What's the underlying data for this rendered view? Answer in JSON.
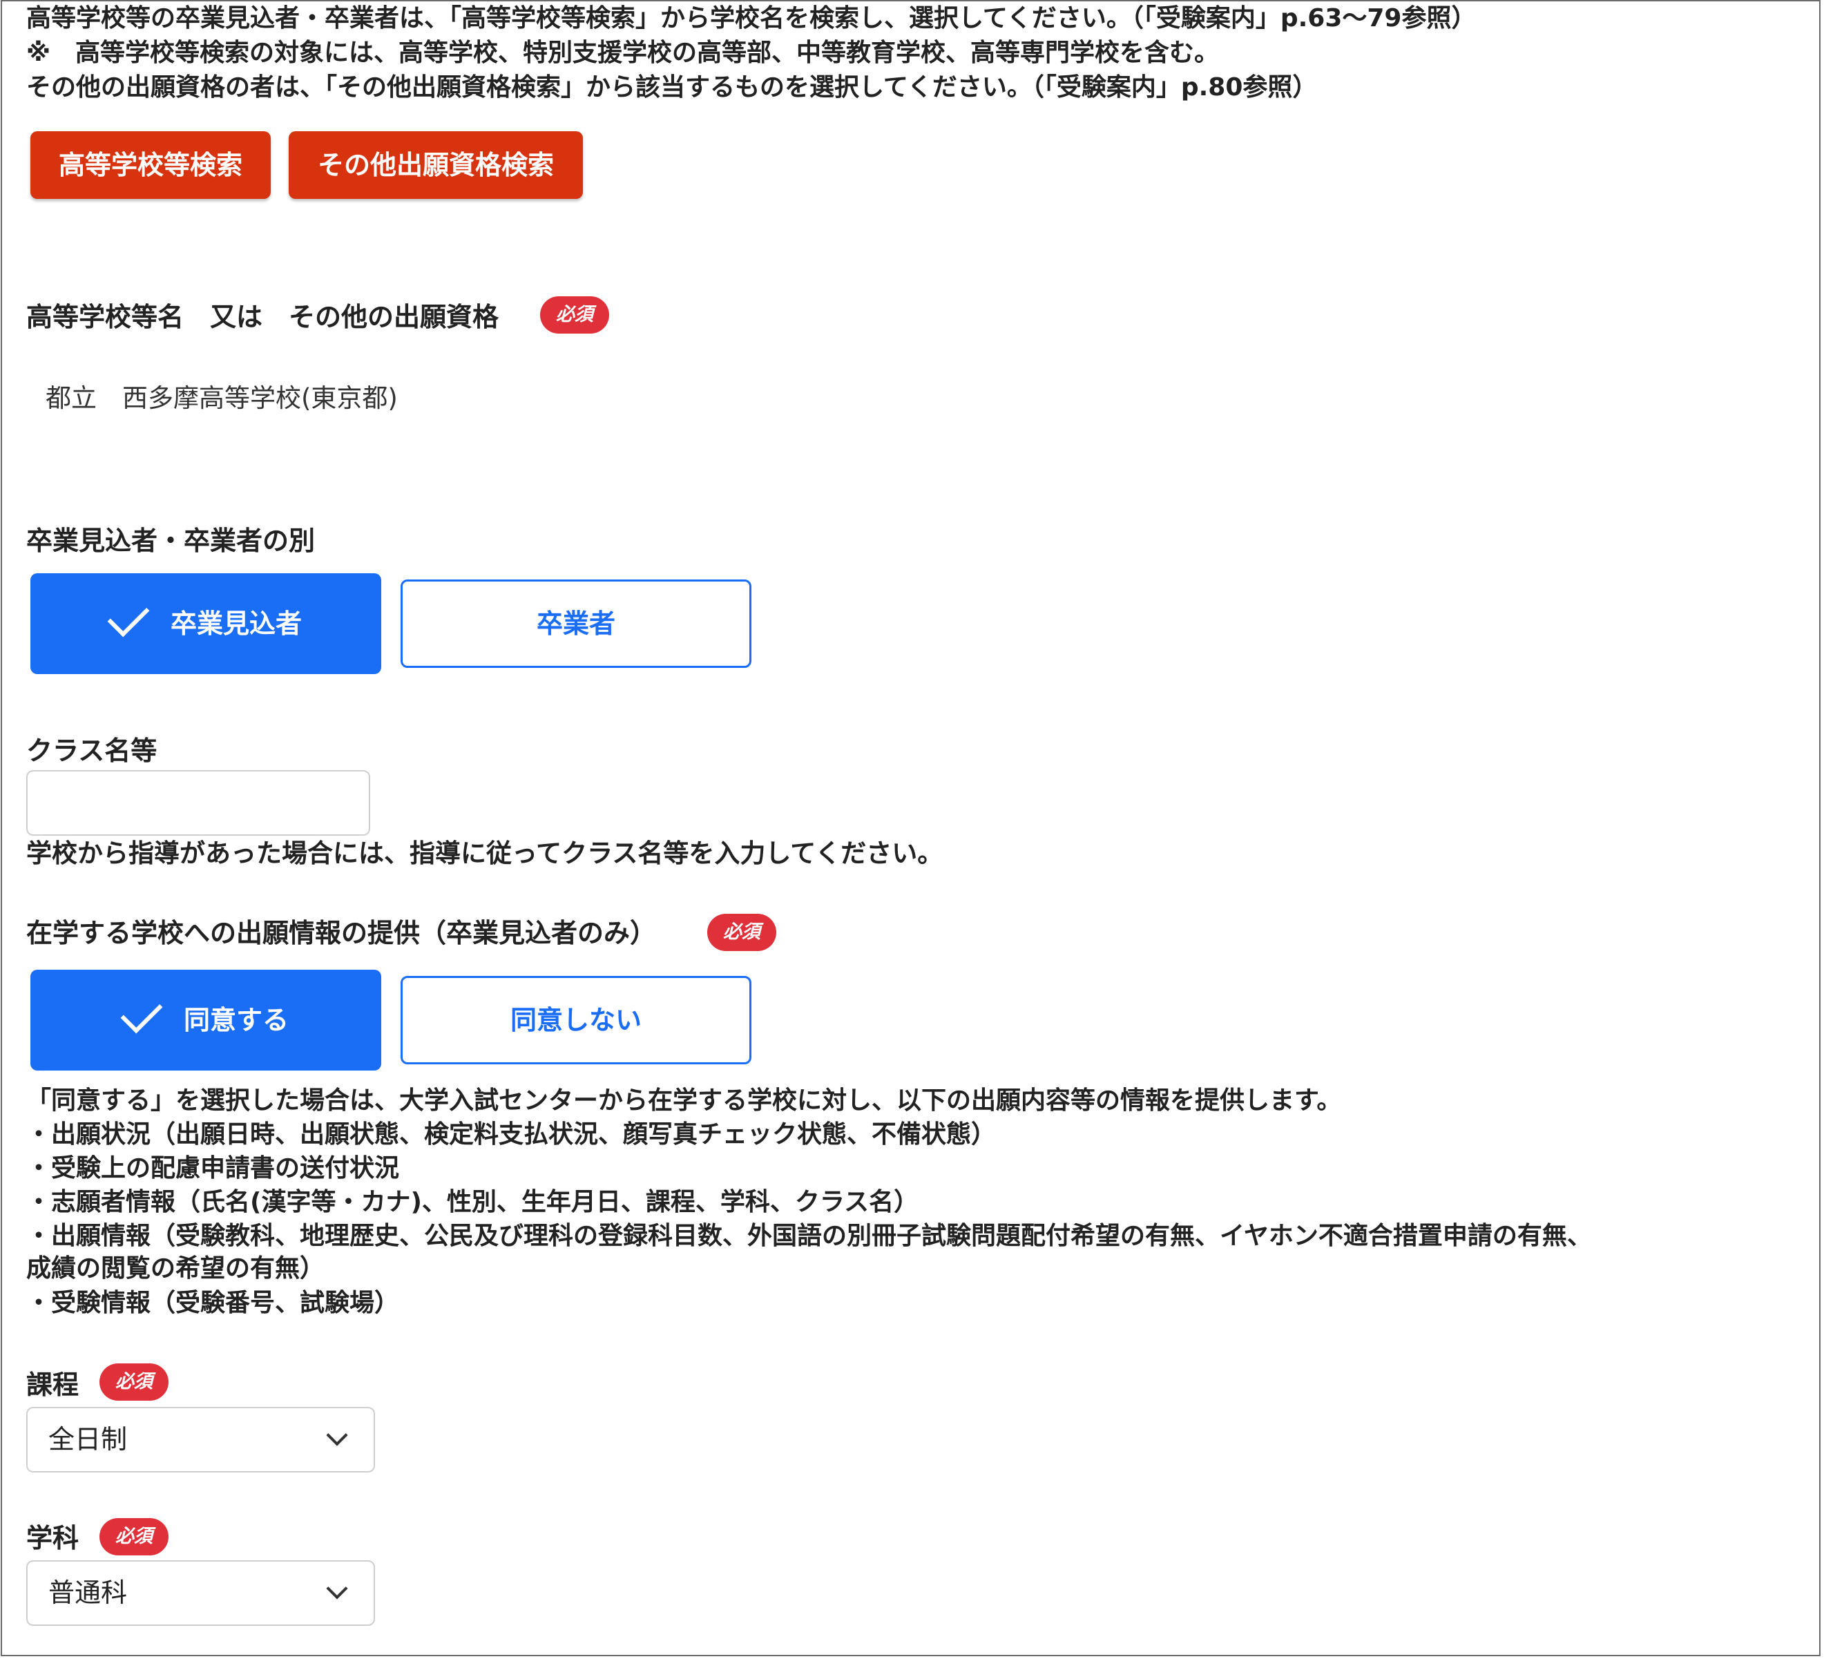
{
  "intro": {
    "line1": "高等学校等の卒業見込者・卒業者は、「高等学校等検索」から学校名を検索し、選択してください。（「受験案内」p.63～79参照）",
    "line2": "※　高等学校等検索の対象には、高等学校、特別支援学校の高等部、中等教育学校、高等専門学校を含む。",
    "line3": "その他の出願資格の者は、「その他出願資格検索」から該当するものを選択してください。（「受験案内」p.80参照）"
  },
  "buttons": {
    "school_search": "高等学校等検索",
    "other_search": "その他出願資格検索"
  },
  "required_badge": "必須",
  "school": {
    "label": "高等学校等名　又は　その他の出願資格",
    "value": "都立　西多摩高等学校(東京都)"
  },
  "graduation": {
    "label": "卒業見込者・卒業者の別",
    "options": [
      "卒業見込者",
      "卒業者"
    ],
    "selected": "卒業見込者"
  },
  "class_name": {
    "label": "クラス名等",
    "value": "",
    "help": "学校から指導があった場合には、指導に従ってクラス名等を入力してください。"
  },
  "consent": {
    "label": "在学する学校への出願情報の提供（卒業見込者のみ）",
    "options": [
      "同意する",
      "同意しない"
    ],
    "selected": "同意する",
    "notes": [
      "「同意する」を選択した場合は、大学入試センターから在学する学校に対し、以下の出願内容等の情報を提供します。",
      "・出願状況（出願日時、出願状態、検定料支払状況、顔写真チェック状態、不備状態）",
      "・受験上の配慮申請書の送付状況",
      "・志願者情報（氏名(漢字等・カナ)、性別、生年月日、課程、学科、クラス名）",
      "・出願情報（受験教科、地理歴史、公民及び理科の登録科目数、外国語の別冊子試験問題配付希望の有無、イヤホン不適合措置申請の有無、",
      "成績の閲覧の希望の有無）",
      "・受験情報（受験番号、試験場）"
    ]
  },
  "course": {
    "label": "課程",
    "value": "全日制"
  },
  "department": {
    "label": "学科",
    "value": "普通科"
  },
  "colors": {
    "accent": "#1a6ef5",
    "danger": "#d7330f",
    "badge": "#e0303a"
  }
}
